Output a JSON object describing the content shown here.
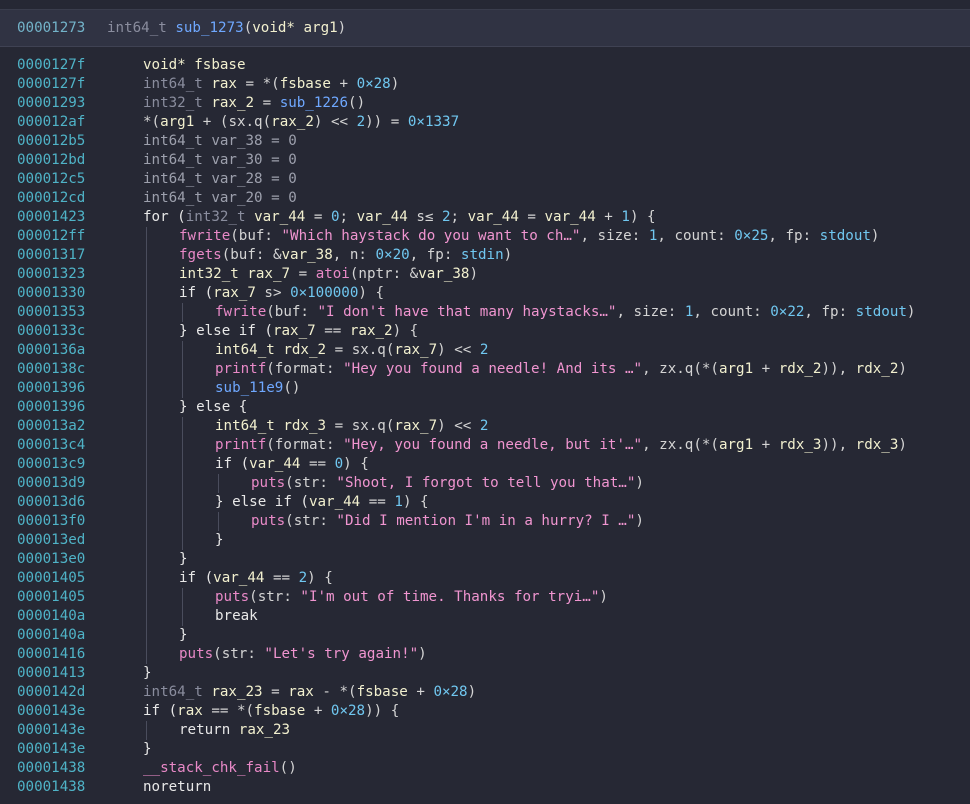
{
  "header": {
    "address": "00001273",
    "signature": [
      {
        "t": "int64_t ",
        "c": "type"
      },
      {
        "t": "sub_1273",
        "c": "fn"
      },
      {
        "t": "(",
        "c": "plain"
      },
      {
        "t": "void* ",
        "c": "var"
      },
      {
        "t": "arg1",
        "c": "var"
      },
      {
        "t": ")",
        "c": "plain"
      }
    ]
  },
  "lines": [
    {
      "addr": "0000127f",
      "indent": 0,
      "tokens": [
        {
          "t": "void* fsbase",
          "c": "var"
        }
      ]
    },
    {
      "addr": "0000127f",
      "indent": 0,
      "tokens": [
        {
          "t": "int64_t ",
          "c": "type"
        },
        {
          "t": "rax",
          "c": "var"
        },
        {
          "t": " = *(",
          "c": "plain"
        },
        {
          "t": "fsbase",
          "c": "var"
        },
        {
          "t": " + ",
          "c": "plain"
        },
        {
          "t": "0×28",
          "c": "num"
        },
        {
          "t": ")",
          "c": "plain"
        }
      ]
    },
    {
      "addr": "00001293",
      "indent": 0,
      "tokens": [
        {
          "t": "int32_t ",
          "c": "type"
        },
        {
          "t": "rax_2",
          "c": "var"
        },
        {
          "t": " = ",
          "c": "plain"
        },
        {
          "t": "sub_1226",
          "c": "fn"
        },
        {
          "t": "()",
          "c": "plain"
        }
      ]
    },
    {
      "addr": "000012af",
      "indent": 0,
      "tokens": [
        {
          "t": "*(",
          "c": "plain"
        },
        {
          "t": "arg1",
          "c": "var"
        },
        {
          "t": " + (",
          "c": "plain"
        },
        {
          "t": "sx.q",
          "c": "plain"
        },
        {
          "t": "(",
          "c": "plain"
        },
        {
          "t": "rax_2",
          "c": "var"
        },
        {
          "t": ") << ",
          "c": "plain"
        },
        {
          "t": "2",
          "c": "num"
        },
        {
          "t": ")) = ",
          "c": "plain"
        },
        {
          "t": "0×1337",
          "c": "num"
        }
      ]
    },
    {
      "addr": "000012b5",
      "indent": 0,
      "tokens": [
        {
          "t": "int64_t var_38 = ",
          "c": "dim"
        },
        {
          "t": "0",
          "c": "dim"
        }
      ]
    },
    {
      "addr": "000012bd",
      "indent": 0,
      "tokens": [
        {
          "t": "int64_t var_30 = ",
          "c": "dim"
        },
        {
          "t": "0",
          "c": "dim"
        }
      ]
    },
    {
      "addr": "000012c5",
      "indent": 0,
      "tokens": [
        {
          "t": "int64_t var_28 = ",
          "c": "dim"
        },
        {
          "t": "0",
          "c": "dim"
        }
      ]
    },
    {
      "addr": "000012cd",
      "indent": 0,
      "tokens": [
        {
          "t": "int64_t var_20 = ",
          "c": "dim"
        },
        {
          "t": "0",
          "c": "dim"
        }
      ]
    },
    {
      "addr": "00001423",
      "indent": 0,
      "tokens": [
        {
          "t": "for (",
          "c": "kw"
        },
        {
          "t": "int32_t ",
          "c": "type"
        },
        {
          "t": "var_44",
          "c": "var"
        },
        {
          "t": " = ",
          "c": "plain"
        },
        {
          "t": "0",
          "c": "num"
        },
        {
          "t": "; ",
          "c": "plain"
        },
        {
          "t": "var_44",
          "c": "var"
        },
        {
          "t": " s≤ ",
          "c": "plain"
        },
        {
          "t": "2",
          "c": "num"
        },
        {
          "t": "; ",
          "c": "plain"
        },
        {
          "t": "var_44",
          "c": "var"
        },
        {
          "t": " = ",
          "c": "plain"
        },
        {
          "t": "var_44",
          "c": "var"
        },
        {
          "t": " + ",
          "c": "plain"
        },
        {
          "t": "1",
          "c": "num"
        },
        {
          "t": ") {",
          "c": "plain"
        }
      ]
    },
    {
      "addr": "000012ff",
      "indent": 1,
      "tokens": [
        {
          "t": "fwrite",
          "c": "ext"
        },
        {
          "t": "(buf: ",
          "c": "plain"
        },
        {
          "t": "\"Which haystack do you want to ch…\"",
          "c": "str"
        },
        {
          "t": ", size: ",
          "c": "plain"
        },
        {
          "t": "1",
          "c": "num"
        },
        {
          "t": ", count: ",
          "c": "plain"
        },
        {
          "t": "0×25",
          "c": "num"
        },
        {
          "t": ", fp: ",
          "c": "plain"
        },
        {
          "t": "stdout",
          "c": "num"
        },
        {
          "t": ")",
          "c": "plain"
        }
      ]
    },
    {
      "addr": "00001317",
      "indent": 1,
      "tokens": [
        {
          "t": "fgets",
          "c": "ext"
        },
        {
          "t": "(buf: &",
          "c": "plain"
        },
        {
          "t": "var_38",
          "c": "var"
        },
        {
          "t": ", n: ",
          "c": "plain"
        },
        {
          "t": "0×20",
          "c": "num"
        },
        {
          "t": ", fp: ",
          "c": "plain"
        },
        {
          "t": "stdin",
          "c": "num"
        },
        {
          "t": ")",
          "c": "plain"
        }
      ]
    },
    {
      "addr": "00001323",
      "indent": 1,
      "tokens": [
        {
          "t": "int32_t ",
          "c": "var"
        },
        {
          "t": "rax_7",
          "c": "var"
        },
        {
          "t": " = ",
          "c": "plain"
        },
        {
          "t": "atoi",
          "c": "ext"
        },
        {
          "t": "(nptr: &",
          "c": "plain"
        },
        {
          "t": "var_38",
          "c": "var"
        },
        {
          "t": ")",
          "c": "plain"
        }
      ]
    },
    {
      "addr": "00001330",
      "indent": 1,
      "tokens": [
        {
          "t": "if (",
          "c": "kw"
        },
        {
          "t": "rax_7",
          "c": "var"
        },
        {
          "t": " s> ",
          "c": "plain"
        },
        {
          "t": "0×100000",
          "c": "num"
        },
        {
          "t": ") {",
          "c": "plain"
        }
      ]
    },
    {
      "addr": "00001353",
      "indent": 2,
      "tokens": [
        {
          "t": "fwrite",
          "c": "ext"
        },
        {
          "t": "(buf: ",
          "c": "plain"
        },
        {
          "t": "\"I don't have that many haystacks…\"",
          "c": "str"
        },
        {
          "t": ", size: ",
          "c": "plain"
        },
        {
          "t": "1",
          "c": "num"
        },
        {
          "t": ", count: ",
          "c": "plain"
        },
        {
          "t": "0×22",
          "c": "num"
        },
        {
          "t": ", fp: ",
          "c": "plain"
        },
        {
          "t": "stdout",
          "c": "num"
        },
        {
          "t": ")",
          "c": "plain"
        }
      ]
    },
    {
      "addr": "0000133c",
      "indent": 1,
      "tokens": [
        {
          "t": "} else if (",
          "c": "kw"
        },
        {
          "t": "rax_7",
          "c": "var"
        },
        {
          "t": " == ",
          "c": "plain"
        },
        {
          "t": "rax_2",
          "c": "var"
        },
        {
          "t": ") {",
          "c": "plain"
        }
      ]
    },
    {
      "addr": "0000136a",
      "indent": 2,
      "tokens": [
        {
          "t": "int64_t ",
          "c": "var"
        },
        {
          "t": "rdx_2",
          "c": "var"
        },
        {
          "t": " = ",
          "c": "plain"
        },
        {
          "t": "sx.q",
          "c": "plain"
        },
        {
          "t": "(",
          "c": "plain"
        },
        {
          "t": "rax_7",
          "c": "var"
        },
        {
          "t": ") << ",
          "c": "plain"
        },
        {
          "t": "2",
          "c": "num"
        }
      ]
    },
    {
      "addr": "0000138c",
      "indent": 2,
      "tokens": [
        {
          "t": "printf",
          "c": "ext"
        },
        {
          "t": "(format: ",
          "c": "plain"
        },
        {
          "t": "\"Hey you found a needle! And its …\"",
          "c": "str"
        },
        {
          "t": ", zx.q(*(",
          "c": "plain"
        },
        {
          "t": "arg1",
          "c": "var"
        },
        {
          "t": " + ",
          "c": "plain"
        },
        {
          "t": "rdx_2",
          "c": "var"
        },
        {
          "t": ")), ",
          "c": "plain"
        },
        {
          "t": "rdx_2",
          "c": "var"
        },
        {
          "t": ")",
          "c": "plain"
        }
      ]
    },
    {
      "addr": "00001396",
      "indent": 2,
      "tokens": [
        {
          "t": "sub_11e9",
          "c": "fn"
        },
        {
          "t": "()",
          "c": "plain"
        }
      ]
    },
    {
      "addr": "00001396",
      "indent": 1,
      "tokens": [
        {
          "t": "} else {",
          "c": "kw"
        }
      ]
    },
    {
      "addr": "000013a2",
      "indent": 2,
      "tokens": [
        {
          "t": "int64_t ",
          "c": "var"
        },
        {
          "t": "rdx_3",
          "c": "var"
        },
        {
          "t": " = ",
          "c": "plain"
        },
        {
          "t": "sx.q",
          "c": "plain"
        },
        {
          "t": "(",
          "c": "plain"
        },
        {
          "t": "rax_7",
          "c": "var"
        },
        {
          "t": ") << ",
          "c": "plain"
        },
        {
          "t": "2",
          "c": "num"
        }
      ]
    },
    {
      "addr": "000013c4",
      "indent": 2,
      "tokens": [
        {
          "t": "printf",
          "c": "ext"
        },
        {
          "t": "(format: ",
          "c": "plain"
        },
        {
          "t": "\"Hey, you found a needle, but it'…\"",
          "c": "str"
        },
        {
          "t": ", zx.q(*(",
          "c": "plain"
        },
        {
          "t": "arg1",
          "c": "var"
        },
        {
          "t": " + ",
          "c": "plain"
        },
        {
          "t": "rdx_3",
          "c": "var"
        },
        {
          "t": ")), ",
          "c": "plain"
        },
        {
          "t": "rdx_3",
          "c": "var"
        },
        {
          "t": ")",
          "c": "plain"
        }
      ]
    },
    {
      "addr": "000013c9",
      "indent": 2,
      "tokens": [
        {
          "t": "if (",
          "c": "kw"
        },
        {
          "t": "var_44",
          "c": "var"
        },
        {
          "t": " == ",
          "c": "plain"
        },
        {
          "t": "0",
          "c": "num"
        },
        {
          "t": ") {",
          "c": "plain"
        }
      ]
    },
    {
      "addr": "000013d9",
      "indent": 3,
      "tokens": [
        {
          "t": "puts",
          "c": "ext"
        },
        {
          "t": "(str: ",
          "c": "plain"
        },
        {
          "t": "\"Shoot, I forgot to tell you that…\"",
          "c": "str"
        },
        {
          "t": ")",
          "c": "plain"
        }
      ]
    },
    {
      "addr": "000013d6",
      "indent": 2,
      "tokens": [
        {
          "t": "} else if (",
          "c": "kw"
        },
        {
          "t": "var_44",
          "c": "var"
        },
        {
          "t": " == ",
          "c": "plain"
        },
        {
          "t": "1",
          "c": "num"
        },
        {
          "t": ") {",
          "c": "plain"
        }
      ]
    },
    {
      "addr": "000013f0",
      "indent": 3,
      "tokens": [
        {
          "t": "puts",
          "c": "ext"
        },
        {
          "t": "(str: ",
          "c": "plain"
        },
        {
          "t": "\"Did I mention I'm in a hurry? I …\"",
          "c": "str"
        },
        {
          "t": ")",
          "c": "plain"
        }
      ]
    },
    {
      "addr": "000013ed",
      "indent": 2,
      "tokens": [
        {
          "t": "}",
          "c": "kw"
        }
      ]
    },
    {
      "addr": "000013e0",
      "indent": 1,
      "tokens": [
        {
          "t": "}",
          "c": "kw"
        }
      ]
    },
    {
      "addr": "00001405",
      "indent": 1,
      "tokens": [
        {
          "t": "if (",
          "c": "kw"
        },
        {
          "t": "var_44",
          "c": "var"
        },
        {
          "t": " == ",
          "c": "plain"
        },
        {
          "t": "2",
          "c": "num"
        },
        {
          "t": ") {",
          "c": "plain"
        }
      ]
    },
    {
      "addr": "00001405",
      "indent": 2,
      "tokens": [
        {
          "t": "puts",
          "c": "ext"
        },
        {
          "t": "(str: ",
          "c": "plain"
        },
        {
          "t": "\"I'm out of time. Thanks for tryi…\"",
          "c": "str"
        },
        {
          "t": ")",
          "c": "plain"
        }
      ]
    },
    {
      "addr": "0000140a",
      "indent": 2,
      "tokens": [
        {
          "t": "break",
          "c": "kw"
        }
      ]
    },
    {
      "addr": "0000140a",
      "indent": 1,
      "tokens": [
        {
          "t": "}",
          "c": "kw"
        }
      ]
    },
    {
      "addr": "00001416",
      "indent": 1,
      "tokens": [
        {
          "t": "puts",
          "c": "ext"
        },
        {
          "t": "(str: ",
          "c": "plain"
        },
        {
          "t": "\"Let's try again!\"",
          "c": "str"
        },
        {
          "t": ")",
          "c": "plain"
        }
      ]
    },
    {
      "addr": "00001413",
      "indent": 0,
      "tokens": [
        {
          "t": "}",
          "c": "kw"
        }
      ]
    },
    {
      "addr": "0000142d",
      "indent": 0,
      "tokens": [
        {
          "t": "int64_t ",
          "c": "type"
        },
        {
          "t": "rax_23",
          "c": "var"
        },
        {
          "t": " = ",
          "c": "plain"
        },
        {
          "t": "rax",
          "c": "var"
        },
        {
          "t": " - *(",
          "c": "plain"
        },
        {
          "t": "fsbase",
          "c": "var"
        },
        {
          "t": " + ",
          "c": "plain"
        },
        {
          "t": "0×28",
          "c": "num"
        },
        {
          "t": ")",
          "c": "plain"
        }
      ]
    },
    {
      "addr": "0000143e",
      "indent": 0,
      "tokens": [
        {
          "t": "if (",
          "c": "kw"
        },
        {
          "t": "rax",
          "c": "var"
        },
        {
          "t": " == *(",
          "c": "plain"
        },
        {
          "t": "fsbase",
          "c": "var"
        },
        {
          "t": " + ",
          "c": "plain"
        },
        {
          "t": "0×28",
          "c": "num"
        },
        {
          "t": ")) {",
          "c": "plain"
        }
      ]
    },
    {
      "addr": "0000143e",
      "indent": 1,
      "tokens": [
        {
          "t": "return ",
          "c": "kw"
        },
        {
          "t": "rax_23",
          "c": "var"
        }
      ]
    },
    {
      "addr": "0000143e",
      "indent": 0,
      "tokens": [
        {
          "t": "}",
          "c": "kw"
        }
      ]
    },
    {
      "addr": "00001438",
      "indent": 0,
      "tokens": [
        {
          "t": "__stack_chk_fail",
          "c": "ext"
        },
        {
          "t": "()",
          "c": "plain"
        }
      ]
    },
    {
      "addr": "00001438",
      "indent": 0,
      "tokens": [
        {
          "t": "noreturn",
          "c": "kw"
        }
      ]
    }
  ]
}
